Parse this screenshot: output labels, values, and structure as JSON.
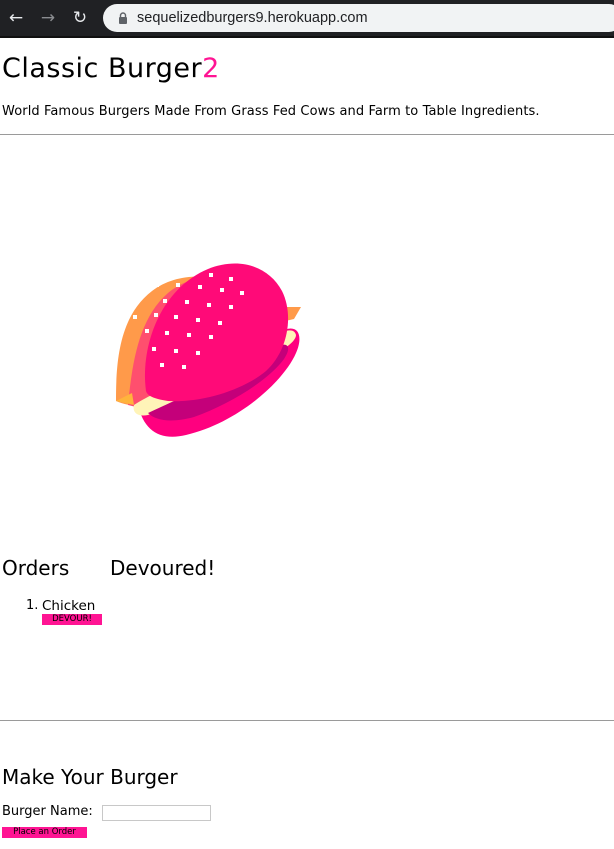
{
  "browser": {
    "url": "sequelizedburgers9.herokuapp.com",
    "icons": [
      "back-arrow-icon",
      "forward-arrow-icon",
      "reload-icon",
      "lock-icon"
    ]
  },
  "header": {
    "title_main": "Classic Burger",
    "title_accent": "2",
    "tagline": "World Famous Burgers Made From Grass Fed Cows and Farm to Table Ingredients."
  },
  "columns": {
    "orders_heading": "Orders",
    "devoured_heading": "Devoured!"
  },
  "orders": [
    {
      "number": "1.",
      "name": "Chicken",
      "button_label": "DEVOUR!"
    }
  ],
  "form": {
    "heading": "Make Your Burger",
    "name_label": "Burger Name:",
    "name_value": "",
    "submit_label": "Place an Order"
  },
  "colors": {
    "accent": "#ff1493",
    "chrome": "#202124"
  }
}
